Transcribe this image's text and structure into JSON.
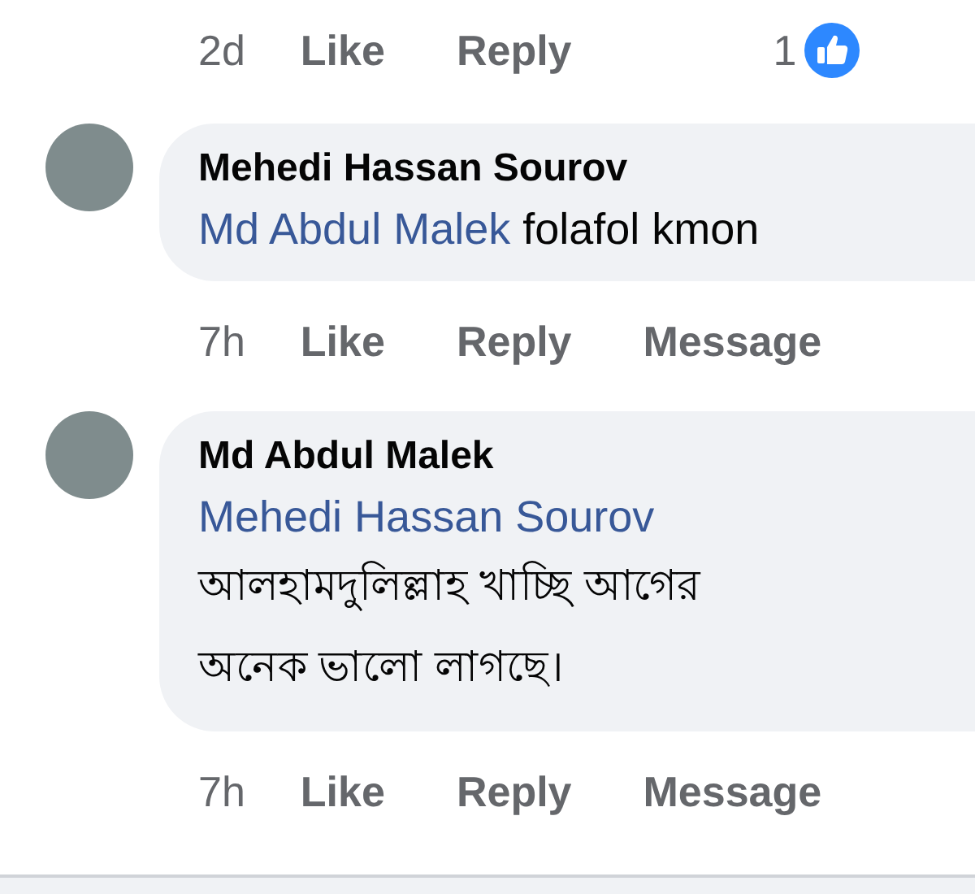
{
  "previous_comment_actions": {
    "time": "2d",
    "actions": [
      "Like",
      "Reply"
    ],
    "reaction_count": "1"
  },
  "replies": [
    {
      "author": "Mehedi Hassan Sourov",
      "mention": "Md Abdul Malek",
      "text_lines": [
        "folafol kmon"
      ],
      "time": "7h",
      "actions": [
        "Like",
        "Reply",
        "Message"
      ]
    },
    {
      "author": "Md Abdul Malek",
      "mention": "Mehedi Hassan Sourov",
      "text_lines": [
        "আলহামদুলিল্লাহ খাচ্ছি আগের",
        "অনেক ভালো লাগছে।"
      ],
      "time": "7h",
      "actions": [
        "Like",
        "Reply",
        "Message"
      ]
    }
  ]
}
